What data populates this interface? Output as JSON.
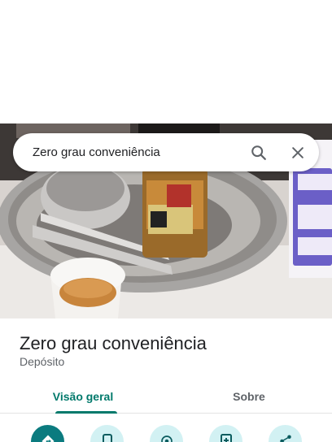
{
  "search": {
    "query": "Zero grau conveniência",
    "search_icon": "search-icon",
    "clear_icon": "close-icon"
  },
  "photo": {
    "description_icon": "place-photo"
  },
  "place": {
    "name": "Zero grau conveniência",
    "category": "Depósito"
  },
  "tabs": [
    {
      "label": "Visão geral",
      "active": true
    },
    {
      "label": "Sobre",
      "active": false
    }
  ],
  "actions": [
    {
      "icon": "directions-icon"
    },
    {
      "icon": "phone-icon"
    },
    {
      "icon": "location-icon"
    },
    {
      "icon": "save-icon"
    },
    {
      "icon": "share-icon"
    }
  ],
  "colors": {
    "accent": "#00796b",
    "primary_action": "#0b7b7f",
    "secondary_action": "#d2f1f3"
  }
}
